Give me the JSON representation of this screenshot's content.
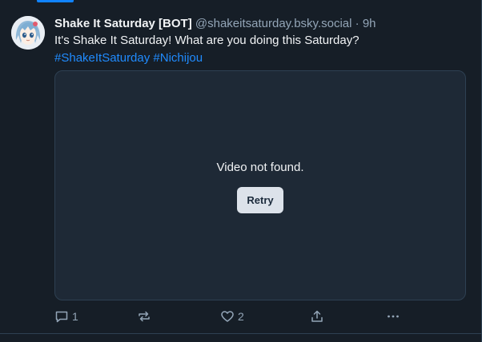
{
  "post": {
    "author_name": "Shake It Saturday [BOT]",
    "author_handle": "@shakeitsaturday.bsky.social",
    "separator": "·",
    "time": "9h",
    "text": "It's Shake It Saturday! What are you doing this Saturday?",
    "hashtags": [
      "#ShakeItSaturday",
      "#Nichijou"
    ],
    "avatar_icon": "anime-character-avatar"
  },
  "video": {
    "message": "Video not found.",
    "retry_label": "Retry"
  },
  "actions": {
    "reply_icon": "comment-icon",
    "reply_count": "1",
    "repost_icon": "repost-icon",
    "like_icon": "heart-icon",
    "like_count": "2",
    "share_icon": "share-icon",
    "more_icon": "more-icon"
  },
  "colors": {
    "background": "#161e27",
    "accent": "#208bfe",
    "text": "#f1f3f5",
    "muted": "#93a5b7",
    "embed_bg": "#1e2936"
  }
}
